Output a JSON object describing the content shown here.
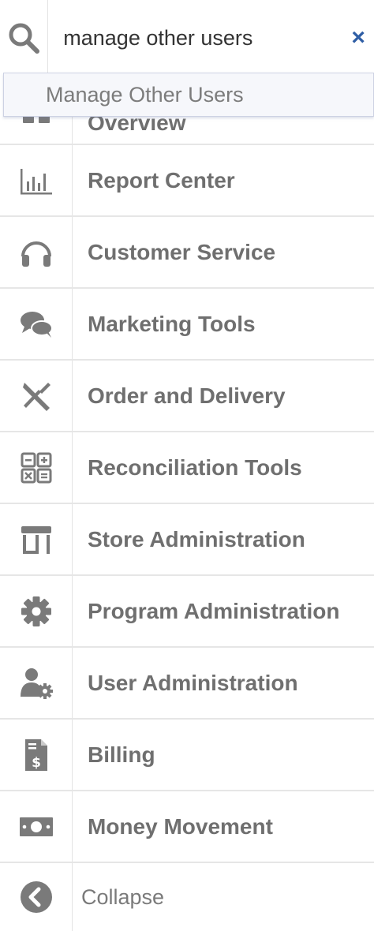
{
  "search": {
    "value": "manage other users",
    "icon": "search-icon",
    "clear_label": "×"
  },
  "suggestions": [
    {
      "label": "Manage Other Users"
    }
  ],
  "menu": {
    "items": [
      {
        "label": "Overview",
        "icon": "overview-grid-icon"
      },
      {
        "label": "Report Center",
        "icon": "bar-chart-icon"
      },
      {
        "label": "Customer Service",
        "icon": "headphones-icon"
      },
      {
        "label": "Marketing Tools",
        "icon": "chat-bubbles-icon"
      },
      {
        "label": "Order and Delivery",
        "icon": "utensils-icon"
      },
      {
        "label": "Reconciliation Tools",
        "icon": "calculator-icon"
      },
      {
        "label": "Store Administration",
        "icon": "storefront-icon"
      },
      {
        "label": "Program Administration",
        "icon": "gear-icon"
      },
      {
        "label": "User Administration",
        "icon": "user-gear-icon"
      },
      {
        "label": "Billing",
        "icon": "invoice-dollar-icon"
      },
      {
        "label": "Money Movement",
        "icon": "money-bill-icon"
      }
    ],
    "collapse_label": "Collapse"
  },
  "colors": {
    "icon": "#7a7a7a",
    "label": "#6f6f6f",
    "clear": "#2f5ea5",
    "suggestion_bg": "#f6f7fb"
  }
}
